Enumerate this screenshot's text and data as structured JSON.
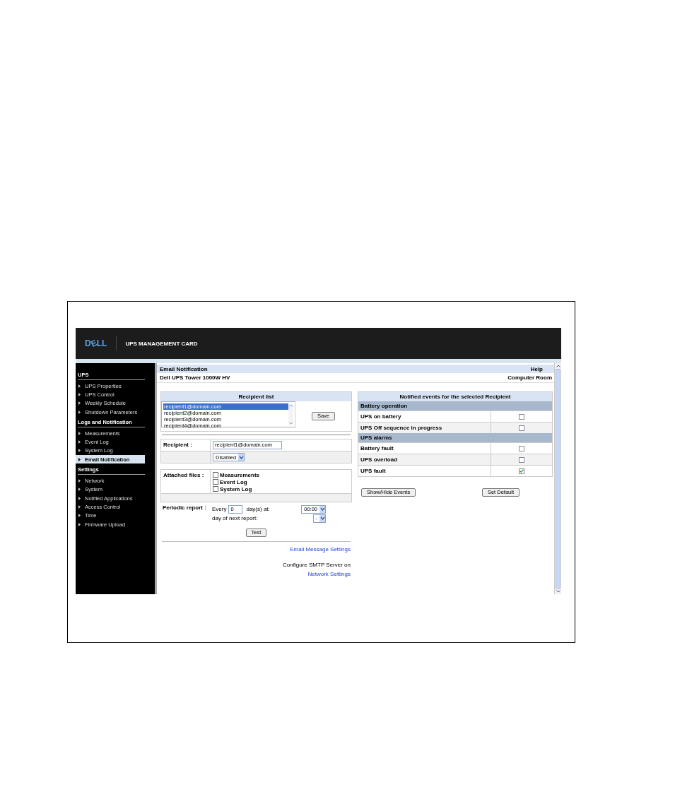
{
  "header": {
    "logo": "DELL",
    "title": "UPS MANAGEMENT CARD"
  },
  "sidebar": [
    {
      "title": "UPS",
      "items": [
        {
          "label": "UPS Properties",
          "selected": false
        },
        {
          "label": "UPS Control",
          "selected": false
        },
        {
          "label": "Weekly Schedule",
          "selected": false
        },
        {
          "label": "Shutdown Parameters",
          "selected": false
        }
      ]
    },
    {
      "title": "Logs and Notification",
      "items": [
        {
          "label": "Measurements",
          "selected": false
        },
        {
          "label": "Event Log",
          "selected": false
        },
        {
          "label": "System Log",
          "selected": false
        },
        {
          "label": "Email Notification",
          "selected": true
        }
      ]
    },
    {
      "title": "Settings",
      "items": [
        {
          "label": "Network",
          "selected": false
        },
        {
          "label": "System",
          "selected": false
        },
        {
          "label": "Notified Applications",
          "selected": false
        },
        {
          "label": "Access Control",
          "selected": false
        },
        {
          "label": "Time",
          "selected": false
        },
        {
          "label": "Firmware Upload",
          "selected": false
        }
      ]
    }
  ],
  "page": {
    "title": "Email Notification",
    "help": "Help",
    "device": "Dell UPS Tower 1000W HV",
    "location": "Computer Room"
  },
  "recipient_list": {
    "title": "Recipient list",
    "items": [
      {
        "text": "recipient1@domain.com",
        "selected": true
      },
      {
        "text": "recipient2@domain.com",
        "selected": false
      },
      {
        "text": "recipient3@domain.com",
        "selected": false
      },
      {
        "text": "recipient4@domain.com",
        "selected": false
      }
    ],
    "save": "Save"
  },
  "recipient": {
    "label": "Recipient :",
    "value": "recipient1@domain.com",
    "status": "Disabled"
  },
  "attached": {
    "label": "Attached files :",
    "files": [
      {
        "label": "Measurements",
        "checked": false
      },
      {
        "label": "Event Log",
        "checked": false
      },
      {
        "label": "System Log",
        "checked": false
      }
    ]
  },
  "periodic": {
    "label": "Periodic report :",
    "every": "Every",
    "days": "0",
    "days_suffix": "day(s) at:",
    "time": "00:00",
    "next_label": "day of next report:",
    "next_value": "-"
  },
  "test": "Test",
  "links": {
    "email_settings": "Email Message Settings",
    "smtp_text": "Configure SMTP Server on",
    "network_settings": "Network Settings"
  },
  "events": {
    "title": "Notified events for the selected Recipient",
    "groups": [
      {
        "title": "Battery operation",
        "events": [
          {
            "label": "UPS on battery",
            "checked": false
          },
          {
            "label": "UPS Off sequence in progress",
            "checked": false
          }
        ]
      },
      {
        "title": "UPS alarms",
        "events": [
          {
            "label": "Battery fault",
            "checked": false
          },
          {
            "label": "UPS overload",
            "checked": false
          },
          {
            "label": "UPS fault",
            "checked": true
          }
        ]
      }
    ],
    "show_hide": "Show/Hide Events",
    "set_default": "Set Default"
  }
}
